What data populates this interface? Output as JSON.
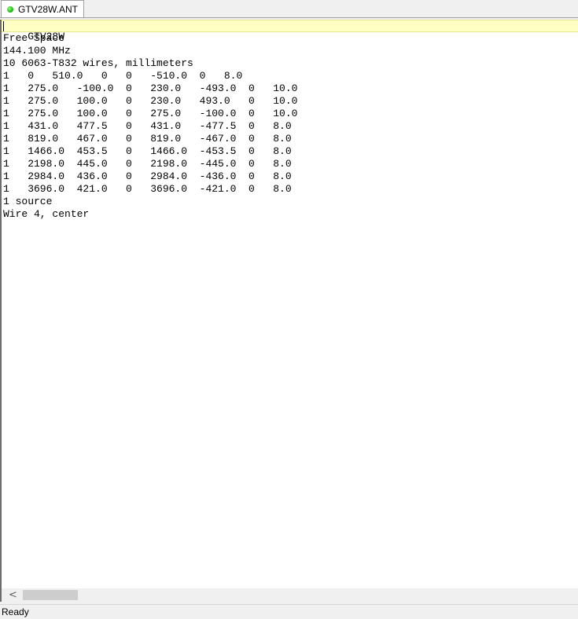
{
  "tab": {
    "title": "GTV28W.ANT",
    "icon": "green-dot-icon"
  },
  "editor": {
    "lines": [
      "GTV28W",
      "Free Space",
      "144.100 MHz",
      "10 6063-T832 wires, millimeters",
      "1   0   510.0   0   0   -510.0  0   8.0",
      "1   275.0   -100.0  0   230.0   -493.0  0   10.0",
      "1   275.0   100.0   0   230.0   493.0   0   10.0",
      "1   275.0   100.0   0   275.0   -100.0  0   10.0",
      "1   431.0   477.5   0   431.0   -477.5  0   8.0",
      "1   819.0   467.0   0   819.0   -467.0  0   8.0",
      "1   1466.0  453.5   0   1466.0  -453.5  0   8.0",
      "1   2198.0  445.0   0   2198.0  -445.0  0   8.0",
      "1   2984.0  436.0   0   2984.0  -436.0  0   8.0",
      "1   3696.0  421.0   0   3696.0  -421.0  0   8.0",
      "1 source",
      "Wire 4, center"
    ]
  },
  "scrollbar": {
    "left_arrow": "<"
  },
  "status": {
    "text": "Ready"
  }
}
